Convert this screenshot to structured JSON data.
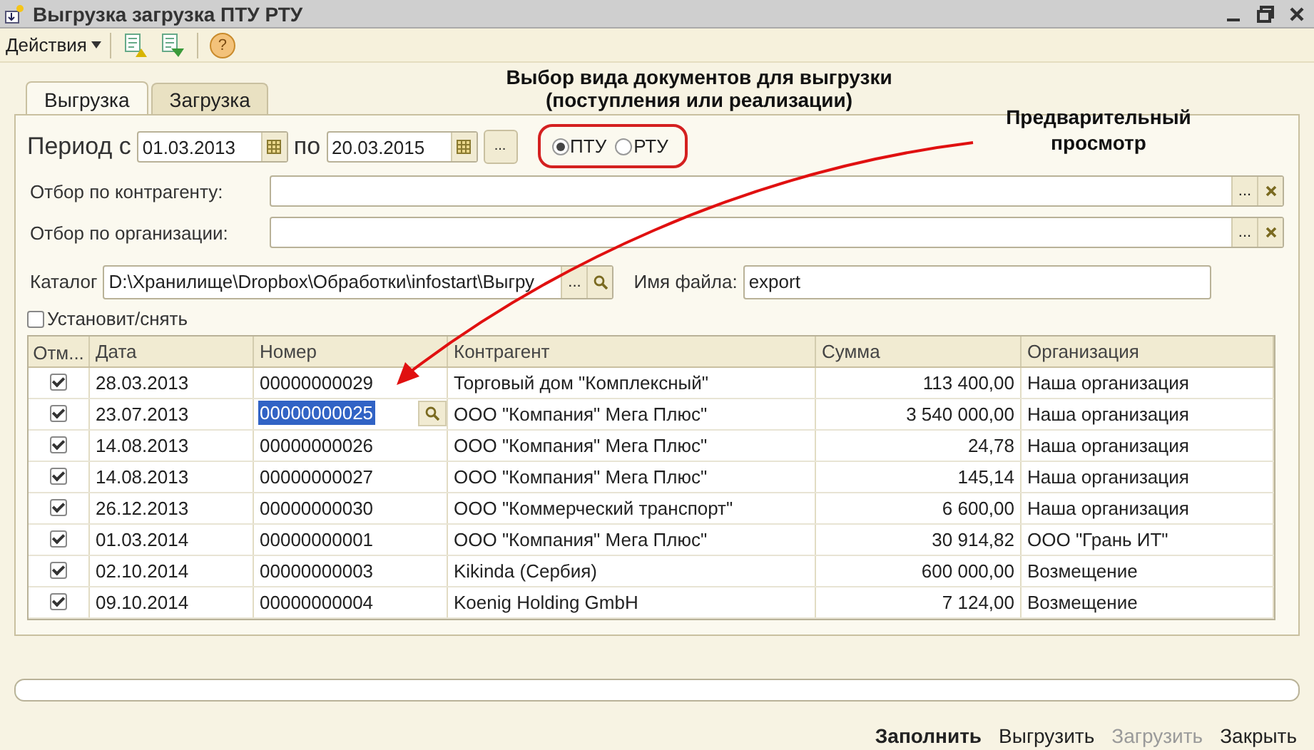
{
  "window": {
    "title": "Выгрузка загрузка ПТУ РТУ"
  },
  "toolbar": {
    "actions_menu": "Действия",
    "help_glyph": "?"
  },
  "annotations": [
    {
      "kind": "top",
      "text": "Выбор вида документов для выгрузки\n(поступления или реализации)"
    },
    {
      "kind": "side",
      "text": "Предварительный\nпросмотр"
    }
  ],
  "tabs": [
    {
      "label": "Выгрузка",
      "selected": true
    },
    {
      "label": "Загрузка",
      "selected": false
    }
  ],
  "period": {
    "label_from": "Период с",
    "from": "01.03.2013",
    "label_to": "по",
    "to": "20.03.2015",
    "button_label": "..."
  },
  "doc_types": [
    {
      "label": "ПТУ",
      "selected": true
    },
    {
      "label": "РТУ",
      "selected": false
    }
  ],
  "filters": [
    {
      "label": "Отбор по контрагенту:",
      "button_label": "..."
    },
    {
      "label": "Отбор по организации:",
      "button_label": "..."
    }
  ],
  "catalog": {
    "label": "Каталог",
    "button_label": "...",
    "value": "D:\\Хранилище\\Dropbox\\Обработки\\infostart\\Выгру"
  },
  "file_name": {
    "label": "Имя файла:",
    "value": "export"
  },
  "select_all": {
    "label": "Установит/снять",
    "checked": false
  },
  "table": {
    "columns": [
      "Отм...",
      "Дата",
      "Номер",
      "Контрагент",
      "Сумма",
      "Организация"
    ],
    "rows": [
      {
        "checked": true,
        "selected": false,
        "date": "28.03.2013",
        "number": "00000000029",
        "counterparty": "Торговый дом \"Комплексный\"",
        "sum": "113 400,00",
        "organization": "Наша организация"
      },
      {
        "checked": true,
        "selected": true,
        "date": "23.07.2013",
        "number": "00000000025",
        "counterparty": "ООО \"Компания\" Мега Плюс\"",
        "sum": "3 540 000,00",
        "organization": "Наша организация"
      },
      {
        "checked": true,
        "selected": false,
        "date": "14.08.2013",
        "number": "00000000026",
        "counterparty": "ООО \"Компания\" Мега Плюс\"",
        "sum": "24,78",
        "organization": "Наша организация"
      },
      {
        "checked": true,
        "selected": false,
        "date": "14.08.2013",
        "number": "00000000027",
        "counterparty": "ООО \"Компания\" Мега Плюс\"",
        "sum": "145,14",
        "organization": "Наша организация"
      },
      {
        "checked": true,
        "selected": false,
        "date": "26.12.2013",
        "number": "00000000030",
        "counterparty": "ООО \"Коммерческий транспорт\"",
        "sum": "6 600,00",
        "organization": "Наша организация"
      },
      {
        "checked": true,
        "selected": false,
        "date": "01.03.2014",
        "number": "00000000001",
        "counterparty": "ООО \"Компания\" Мега Плюс\"",
        "sum": "30 914,82",
        "organization": "ООО \"Грань ИТ\""
      },
      {
        "checked": true,
        "selected": false,
        "date": "02.10.2014",
        "number": "00000000003",
        "counterparty": "Kikinda (Сербия)",
        "sum": "600 000,00",
        "organization": "Возмещение"
      },
      {
        "checked": true,
        "selected": false,
        "date": "09.10.2014",
        "number": "00000000004",
        "counterparty": "Koenig Holding GmbH",
        "sum": "7 124,00",
        "organization": "Возмещение"
      }
    ]
  },
  "progress": {
    "level": 0
  },
  "buttons": [
    {
      "label": "Заполнить",
      "kind": "default",
      "disabled": false
    },
    {
      "label": "Выгрузить",
      "kind": "normal",
      "disabled": false
    },
    {
      "label": "Загрузить",
      "kind": "normal",
      "disabled": true
    },
    {
      "label": "Закрыть",
      "kind": "normal",
      "disabled": false
    }
  ]
}
